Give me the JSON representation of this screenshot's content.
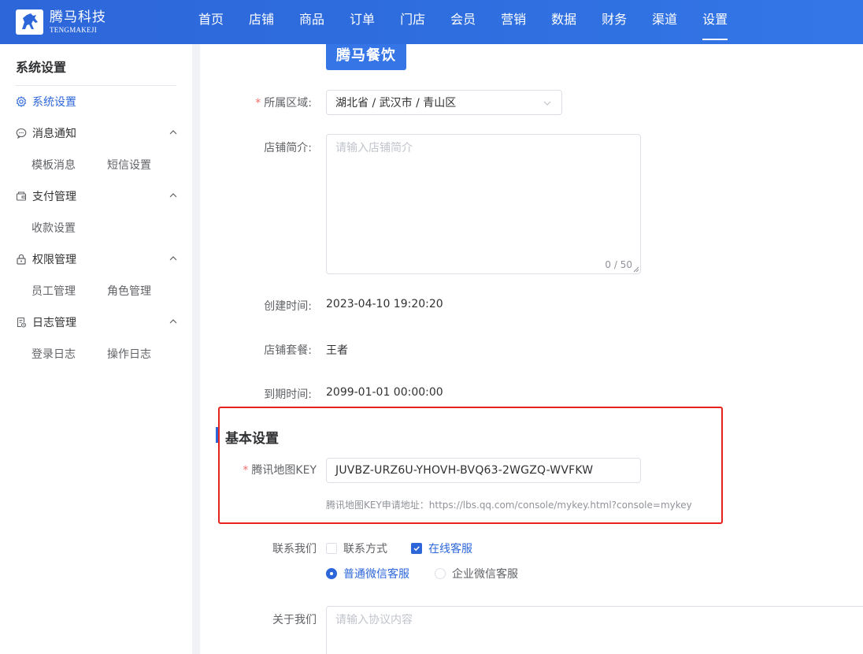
{
  "brand": {
    "name_cn": "腾马科技",
    "name_en": "TENGMAKEJI"
  },
  "nav": {
    "items": [
      "首页",
      "店铺",
      "商品",
      "订单",
      "门店",
      "会员",
      "营销",
      "数据",
      "财务",
      "渠道",
      "设置"
    ],
    "active": "设置"
  },
  "sidebar": {
    "title": "系统设置",
    "menu": {
      "system": "系统设置",
      "message": "消息通知",
      "payment": "支付管理",
      "permission": "权限管理",
      "log": "日志管理"
    },
    "sub": {
      "template_msg": "模板消息",
      "sms_settings": "短信设置",
      "collection_settings": "收款设置",
      "staff_mgmt": "员工管理",
      "role_mgmt": "角色管理",
      "login_log": "登录日志",
      "operation_log": "操作日志"
    }
  },
  "form": {
    "logo_text": "腾马餐饮",
    "region_label": "所属区域:",
    "region_value": "湖北省 / 武汉市 / 青山区",
    "intro_label": "店铺简介:",
    "intro_placeholder": "请输入店铺简介",
    "intro_count": "0 / 50",
    "created_label": "创建时间:",
    "created_value": "2023-04-10 19:20:20",
    "package_label": "店铺套餐:",
    "package_value": "王者",
    "expire_label": "到期时间:",
    "expire_value": "2099-01-01 00:00:00",
    "section_title": "基本设置",
    "map_key_label": "腾讯地图KEY",
    "map_key_value": "JUVBZ-URZ6U-YHOVH-BVQ63-2WGZQ-WVFKW",
    "map_key_hint": "腾讯地图KEY申请地址：https://lbs.qq.com/console/mykey.html?console=mykey",
    "contact_label": "联系我们",
    "contact_method": "联系方式",
    "online_service": "在线客服",
    "wechat_normal": "普通微信客服",
    "wechat_enterprise": "企业微信客服",
    "about_label": "关于我们",
    "about_placeholder": "请输入协议内容"
  },
  "state": {
    "contact_method_checked": false,
    "online_service_checked": true,
    "wechat_type": "普通微信客服"
  },
  "colors": {
    "primary": "#2d66d9",
    "highlight_border": "#e8231d",
    "required": "#f56c6c"
  }
}
